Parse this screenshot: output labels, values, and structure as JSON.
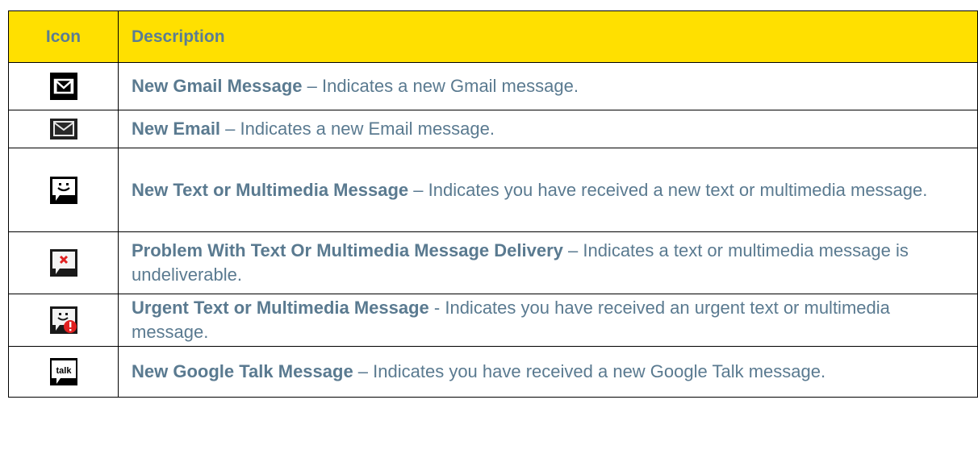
{
  "header": {
    "icon_col": "Icon",
    "desc_col": "Description"
  },
  "rows": [
    {
      "icon": "gmail-icon",
      "title": "New Gmail Message",
      "sep": " – ",
      "text": "Indicates a new Gmail message."
    },
    {
      "icon": "email-icon",
      "title": "New Email",
      "sep": " – ",
      "text": "Indicates a new Email message."
    },
    {
      "icon": "text-message-icon",
      "title": "New Text or Multimedia Message",
      "sep": " – ",
      "text": "Indicates you have received a new text or multimedia message."
    },
    {
      "icon": "message-error-icon",
      "title": "Problem With Text Or Multimedia Message Delivery",
      "sep": " – ",
      "text": "Indicates a text or multimedia message is undeliverable."
    },
    {
      "icon": "urgent-message-icon",
      "title": "Urgent Text or Multimedia Message",
      "sep": " - ",
      "text": "Indicates you have received an urgent text or multimedia message."
    },
    {
      "icon": "google-talk-icon",
      "icon_text": "talk",
      "title": "New Google Talk Message",
      "sep": " – ",
      "text": "Indicates you have received a new Google Talk message."
    }
  ],
  "colors": {
    "header_bg": "#ffe000",
    "text": "#5a7a90",
    "error_red": "#e02020"
  }
}
